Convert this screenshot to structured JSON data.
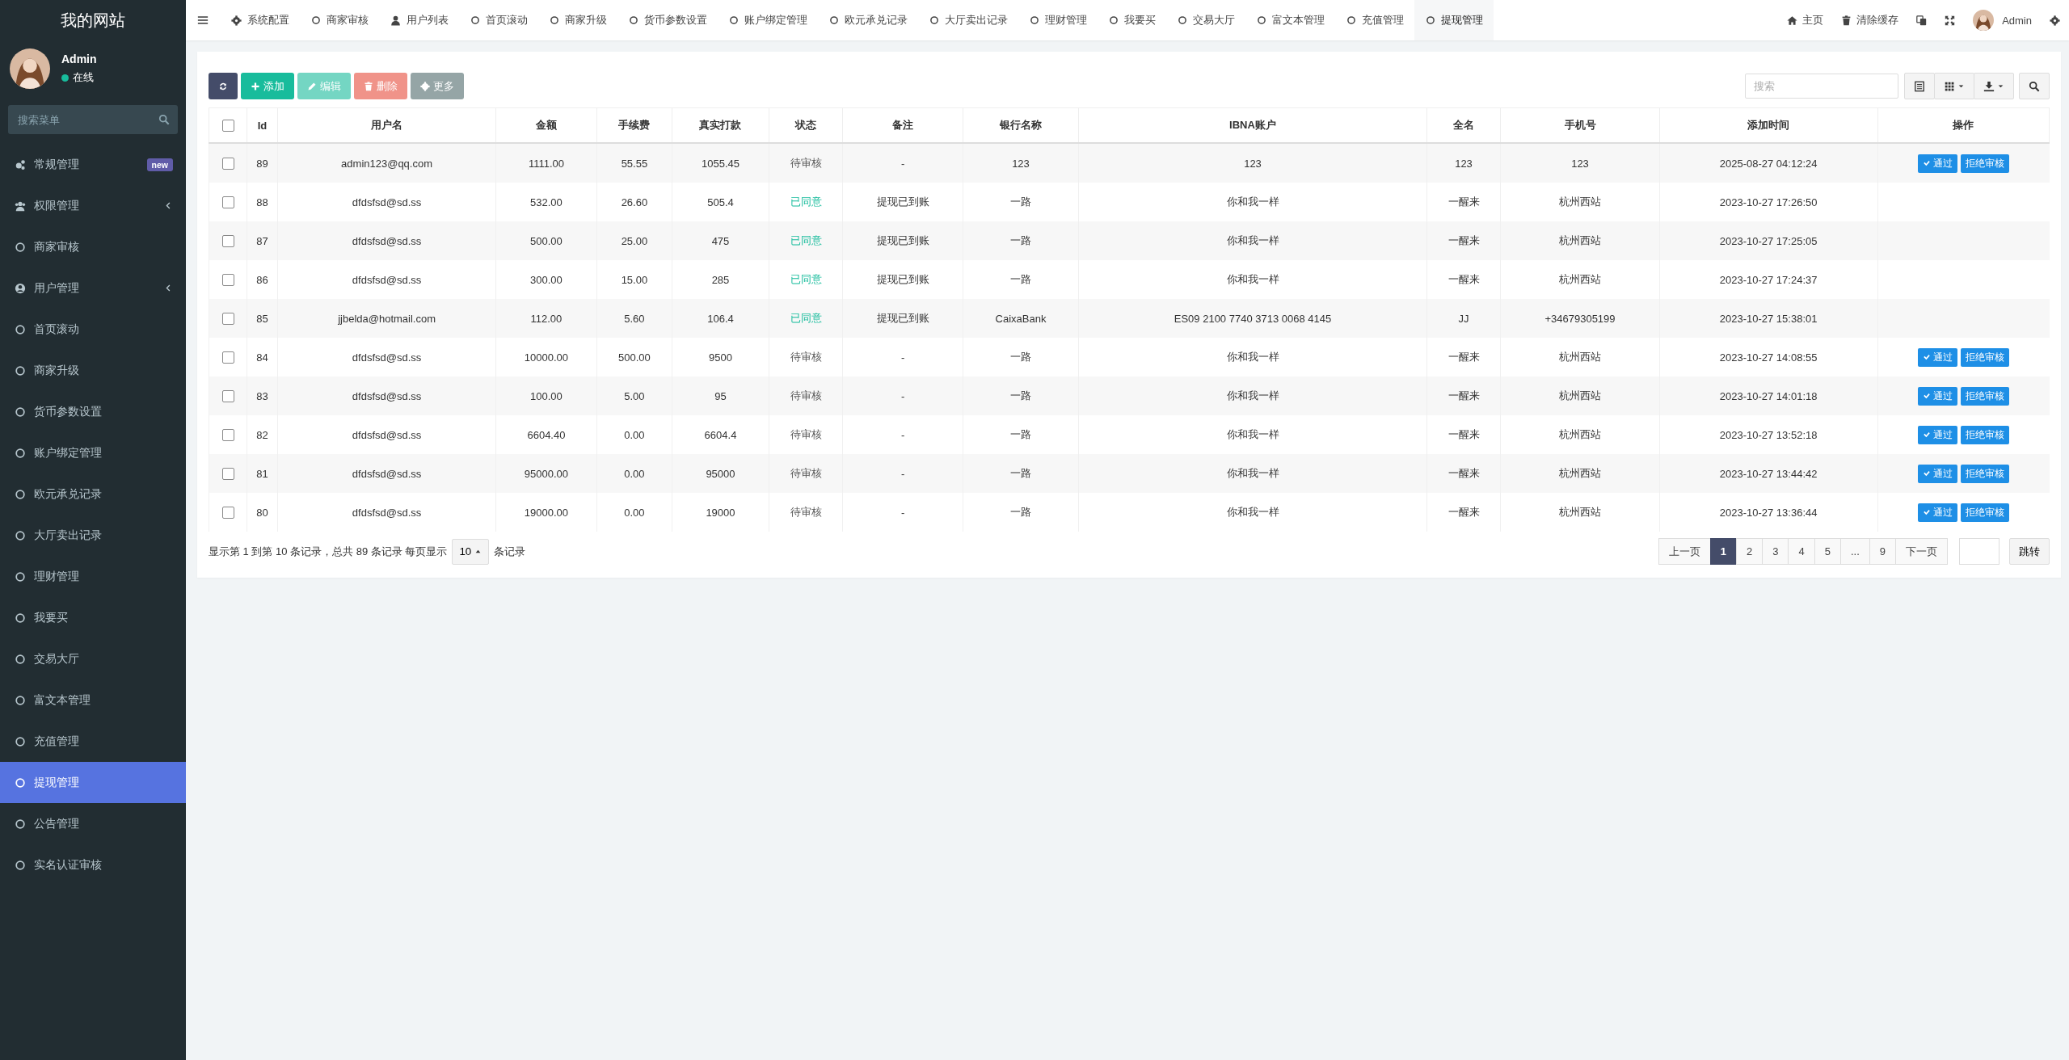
{
  "sidebar": {
    "title": "我的网站",
    "user": {
      "name": "Admin",
      "status": "在线",
      "online": true
    },
    "search": {
      "placeholder": "搜索菜单"
    },
    "items": [
      {
        "label": "常规管理",
        "kind": "gears",
        "badge": "new",
        "expandable": false,
        "selected": false
      },
      {
        "label": "权限管理",
        "kind": "users",
        "expandable": true,
        "selected": false
      },
      {
        "label": "商家审核",
        "expandable": false,
        "selected": false
      },
      {
        "label": "用户管理",
        "kind": "user-circle",
        "expandable": true,
        "selected": false
      },
      {
        "label": "首页滚动",
        "expandable": false,
        "selected": false
      },
      {
        "label": "商家升级",
        "expandable": false,
        "selected": false
      },
      {
        "label": "货币参数设置",
        "expandable": false,
        "selected": false
      },
      {
        "label": "账户绑定管理",
        "expandable": false,
        "selected": false
      },
      {
        "label": "欧元承兑记录",
        "expandable": false,
        "selected": false
      },
      {
        "label": "大厅卖出记录",
        "expandable": false,
        "selected": false
      },
      {
        "label": "理财管理",
        "expandable": false,
        "selected": false
      },
      {
        "label": "我要买",
        "expandable": false,
        "selected": false
      },
      {
        "label": "交易大厅",
        "expandable": false,
        "selected": false
      },
      {
        "label": "富文本管理",
        "expandable": false,
        "selected": false
      },
      {
        "label": "充值管理",
        "expandable": false,
        "selected": false
      },
      {
        "label": "提现管理",
        "expandable": false,
        "selected": true
      },
      {
        "label": "公告管理",
        "expandable": false,
        "selected": false
      },
      {
        "label": "实名认证审核",
        "expandable": false,
        "selected": false
      }
    ]
  },
  "topbar": {
    "tabs": [
      {
        "label": "系统配置",
        "kind": "gear",
        "selected": false
      },
      {
        "label": "商家审核",
        "selected": false
      },
      {
        "label": "用户列表",
        "kind": "user",
        "selected": false
      },
      {
        "label": "首页滚动",
        "selected": false
      },
      {
        "label": "商家升级",
        "selected": false
      },
      {
        "label": "货币参数设置",
        "selected": false
      },
      {
        "label": "账户绑定管理",
        "selected": false
      },
      {
        "label": "欧元承兑记录",
        "selected": false
      },
      {
        "label": "大厅卖出记录",
        "selected": false
      },
      {
        "label": "理财管理",
        "selected": false
      },
      {
        "label": "我要买",
        "selected": false
      },
      {
        "label": "交易大厅",
        "selected": false
      },
      {
        "label": "富文本管理",
        "selected": false
      },
      {
        "label": "充值管理",
        "selected": false
      },
      {
        "label": "提现管理",
        "selected": true
      }
    ],
    "actions": [
      {
        "kind": "home",
        "label": "主页"
      },
      {
        "kind": "clear",
        "label": "清除缓存"
      },
      {
        "kind": "translate"
      },
      {
        "kind": "fullscreen"
      },
      {
        "kind": "user",
        "label": "Admin"
      },
      {
        "kind": "settings"
      }
    ]
  },
  "toolbar": {
    "buttons": [
      {
        "kind": "refresh",
        "disabled": false
      },
      {
        "kind": "add",
        "label": "添加",
        "disabled": false
      },
      {
        "kind": "edit",
        "label": "编辑",
        "disabled": true
      },
      {
        "kind": "delete",
        "label": "删除",
        "disabled": true
      },
      {
        "kind": "more",
        "label": "更多",
        "disabled": false
      }
    ],
    "search": {
      "placeholder": "搜索"
    },
    "tools": [
      {
        "kind": "list"
      },
      {
        "kind": "columns"
      },
      {
        "kind": "export"
      },
      {
        "kind": "search"
      }
    ]
  },
  "table": {
    "select_all_checked": false,
    "columns": [
      "Id",
      "用户名",
      "金额",
      "手续费",
      "真实打款",
      "状态",
      "备注",
      "银行名称",
      "IBNA账户",
      "全名",
      "手机号",
      "添加时间",
      "操作"
    ],
    "rows": [
      {
        "checked": false,
        "cells": [
          "89",
          "admin123@qq.com",
          "1111.00",
          "55.55",
          "1055.45",
          "待审核",
          "-",
          "123",
          "123",
          "123",
          "123",
          "2025-08-27 04:12:24"
        ],
        "approved": false,
        "actions": [
          "通过",
          "拒绝审核"
        ]
      },
      {
        "checked": false,
        "cells": [
          "88",
          "dfdsfsd@sd.ss",
          "532.00",
          "26.60",
          "505.4",
          "已同意",
          "提现已到账",
          "一路",
          "你和我一样",
          "一醒来",
          "杭州西站",
          "2023-10-27 17:26:50"
        ],
        "approved": true,
        "actions": []
      },
      {
        "checked": false,
        "cells": [
          "87",
          "dfdsfsd@sd.ss",
          "500.00",
          "25.00",
          "475",
          "已同意",
          "提现已到账",
          "一路",
          "你和我一样",
          "一醒来",
          "杭州西站",
          "2023-10-27 17:25:05"
        ],
        "approved": true,
        "actions": []
      },
      {
        "checked": false,
        "cells": [
          "86",
          "dfdsfsd@sd.ss",
          "300.00",
          "15.00",
          "285",
          "已同意",
          "提现已到账",
          "一路",
          "你和我一样",
          "一醒来",
          "杭州西站",
          "2023-10-27 17:24:37"
        ],
        "approved": true,
        "actions": []
      },
      {
        "checked": false,
        "cells": [
          "85",
          "jjbelda@hotmail.com",
          "112.00",
          "5.60",
          "106.4",
          "已同意",
          "提现已到账",
          "CaixaBank",
          "ES09 2100 7740 3713 0068 4145",
          "JJ",
          "+34679305199",
          "2023-10-27 15:38:01"
        ],
        "approved": true,
        "actions": []
      },
      {
        "checked": false,
        "cells": [
          "84",
          "dfdsfsd@sd.ss",
          "10000.00",
          "500.00",
          "9500",
          "待审核",
          "-",
          "一路",
          "你和我一样",
          "一醒来",
          "杭州西站",
          "2023-10-27 14:08:55"
        ],
        "approved": false,
        "actions": [
          "通过",
          "拒绝审核"
        ]
      },
      {
        "checked": false,
        "cells": [
          "83",
          "dfdsfsd@sd.ss",
          "100.00",
          "5.00",
          "95",
          "待审核",
          "-",
          "一路",
          "你和我一样",
          "一醒来",
          "杭州西站",
          "2023-10-27 14:01:18"
        ],
        "approved": false,
        "actions": [
          "通过",
          "拒绝审核"
        ]
      },
      {
        "checked": false,
        "cells": [
          "82",
          "dfdsfsd@sd.ss",
          "6604.40",
          "0.00",
          "6604.4",
          "待审核",
          "-",
          "一路",
          "你和我一样",
          "一醒来",
          "杭州西站",
          "2023-10-27 13:52:18"
        ],
        "approved": false,
        "actions": [
          "通过",
          "拒绝审核"
        ]
      },
      {
        "checked": false,
        "cells": [
          "81",
          "dfdsfsd@sd.ss",
          "95000.00",
          "0.00",
          "95000",
          "待审核",
          "-",
          "一路",
          "你和我一样",
          "一醒来",
          "杭州西站",
          "2023-10-27 13:44:42"
        ],
        "approved": false,
        "actions": [
          "通过",
          "拒绝审核"
        ]
      },
      {
        "checked": false,
        "cells": [
          "80",
          "dfdsfsd@sd.ss",
          "19000.00",
          "0.00",
          "19000",
          "待审核",
          "-",
          "一路",
          "你和我一样",
          "一醒来",
          "杭州西站",
          "2023-10-27 13:36:44"
        ],
        "approved": false,
        "actions": [
          "通过",
          "拒绝审核"
        ]
      }
    ]
  },
  "footer": {
    "summary": "显示第 1 到第 10 条记录，总共 89 条记录 每页显示",
    "page_size": "10",
    "summary_end": "条记录",
    "pagination": {
      "prev": "上一页",
      "pages": [
        {
          "label": "1",
          "selected": true
        },
        {
          "label": "2",
          "selected": false
        },
        {
          "label": "3",
          "selected": false
        },
        {
          "label": "4",
          "selected": false
        },
        {
          "label": "5",
          "selected": false
        },
        {
          "label": "...",
          "selected": false
        },
        {
          "label": "9",
          "selected": false
        }
      ],
      "next": "下一页",
      "jump": "跳转"
    }
  }
}
